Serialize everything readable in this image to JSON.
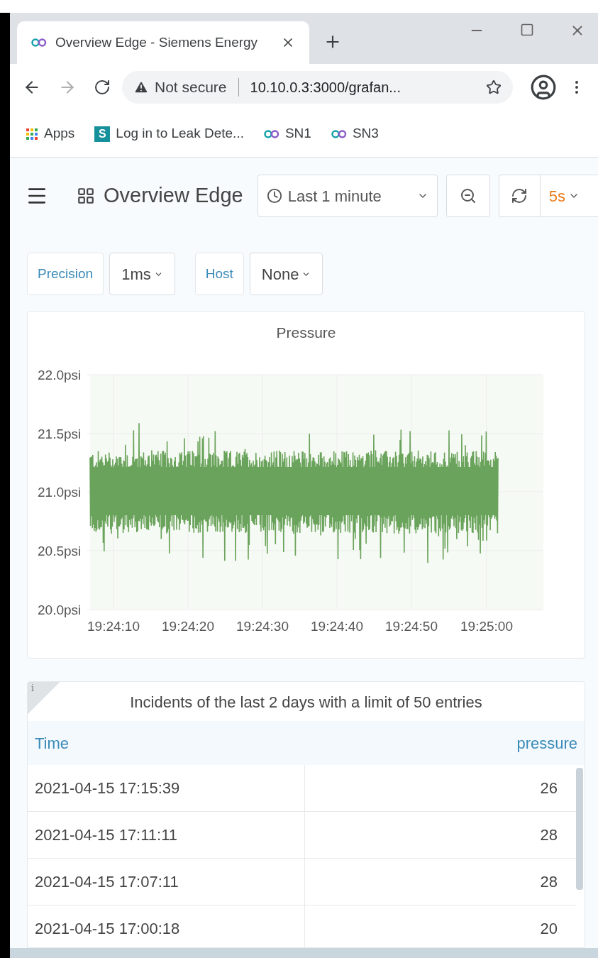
{
  "browser": {
    "tabs": [
      {
        "title": "Overview Edge - Siemens Energy",
        "selected": true
      }
    ],
    "address": {
      "security": "Not secure",
      "url": "10.10.0.3:3000/grafan..."
    },
    "bookmarks": [
      {
        "kind": "apps",
        "label": "Apps"
      },
      {
        "kind": "s",
        "icon_text": "S",
        "label": "Log in to Leak Dete..."
      },
      {
        "kind": "se",
        "label": "SN1"
      },
      {
        "kind": "se",
        "label": "SN3"
      }
    ]
  },
  "dashboard": {
    "title": "Overview Edge",
    "time_range": "Last 1 minute",
    "refresh": "5s",
    "variables": [
      {
        "label": "Precision",
        "value": "1ms"
      },
      {
        "label": "Host",
        "value": "None"
      }
    ]
  },
  "pressure_panel": {
    "title": "Pressure",
    "y_axis_labels": [
      "22.0psi",
      "21.5psi",
      "21.0psi",
      "20.5psi",
      "20.0psi"
    ],
    "x_axis_labels": [
      "19:24:10",
      "19:24:20",
      "19:24:30",
      "19:24:40",
      "19:24:50",
      "19:25:00"
    ]
  },
  "incidents_panel": {
    "info_icon": "i",
    "title": "Incidents of the last 2 days with a limit of 50 entries",
    "columns": [
      "Time",
      "pressure"
    ],
    "rows": [
      [
        "2021-04-15 17:15:39",
        "26"
      ],
      [
        "2021-04-15 17:11:11",
        "28"
      ],
      [
        "2021-04-15 17:07:11",
        "28"
      ],
      [
        "2021-04-15 17:00:18",
        "20"
      ]
    ]
  }
}
